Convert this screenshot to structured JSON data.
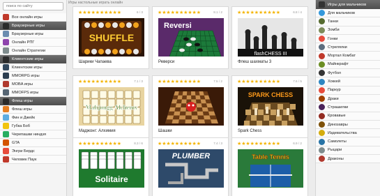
{
  "search": {
    "placeholder": "поиск по сайту"
  },
  "breadcrumb": "Игры настольные играть онлайн",
  "left_sidebar": {
    "top_item": {
      "label": "Все онлайн игры",
      "color": "#c0392b"
    },
    "groups": [
      {
        "title": "Браузерные игры",
        "items": [
          {
            "label": "Браузерные игры",
            "color": "#6a8caf"
          },
          {
            "label": "Онлайн РПГ",
            "color": "#8e44ad"
          },
          {
            "label": "Онлайн Стратегии",
            "color": "#7f8c8d"
          }
        ]
      },
      {
        "title": "Клиентские игры",
        "items": [
          {
            "label": "Клиентские игры",
            "color": "#34495e"
          },
          {
            "label": "MMORPG игры",
            "color": "#2c3e50"
          },
          {
            "label": "MOBA игры",
            "color": "#b03a2e"
          },
          {
            "label": "MMOFPS игры",
            "color": "#566573"
          }
        ]
      },
      {
        "title": "Флеш игры",
        "items": [
          {
            "label": "Флеш игры",
            "color": "#e67e22"
          },
          {
            "label": "Фин и Джейк",
            "color": "#5dade2"
          },
          {
            "label": "Губка Боб",
            "color": "#f1c40f"
          },
          {
            "label": "Черепашки ниндзя",
            "color": "#27ae60"
          },
          {
            "label": "GTA",
            "color": "#d35400"
          },
          {
            "label": "Энгри Бердс",
            "color": "#e74c3c"
          },
          {
            "label": "Человек Паук",
            "color": "#c0392b"
          }
        ]
      }
    ]
  },
  "cards": [
    {
      "title": "Шарики Чапаева",
      "score": "6 / 3",
      "stars": 5,
      "thumb": "shuffle",
      "thumb_text": "SHUFFLE"
    },
    {
      "title": "Реверси",
      "score": "8.1 / 2",
      "stars": 5,
      "thumb": "reversi",
      "thumb_text": "Reversi"
    },
    {
      "title": "Флеш шахматы 3",
      "score": "6.8 / 4",
      "stars": 5,
      "thumb": "chess",
      "thumb_text": "flashCHESS III"
    },
    {
      "title": "Маджонг: Алхимия",
      "score": "7.1 / 3",
      "stars": 5,
      "thumb": "mahjong",
      "thumb_text": "Mahjongg Alchemy"
    },
    {
      "title": "Шашки",
      "score": "7.5 / 2",
      "stars": 5,
      "thumb": "checkers",
      "thumb_text": ""
    },
    {
      "title": "Spark Chess",
      "score": "7.6 / 5",
      "stars": 5,
      "thumb": "spark",
      "thumb_text": "SPARK CHESS"
    },
    {
      "title": "",
      "score": "8.3 / 6",
      "stars": 5,
      "thumb": "solitaire",
      "thumb_text": "Solitaire"
    },
    {
      "title": "",
      "score": "7.4 / 3",
      "stars": 5,
      "thumb": "plumber",
      "thumb_text": "PLUMBER"
    },
    {
      "title": "",
      "score": "6.9 / 2",
      "stars": 5,
      "thumb": "tennis",
      "thumb_text": "Table Tennis"
    }
  ],
  "right_sidebar": {
    "title": "Игры для мальчиков",
    "items": [
      {
        "label": "Для мальчиков",
        "color": "#3498db"
      },
      {
        "label": "Танки",
        "color": "#556b2f"
      },
      {
        "label": "Зомби",
        "color": "#7d8c5a"
      },
      {
        "label": "Гонки",
        "color": "#e74c3c"
      },
      {
        "label": "Стрелялки",
        "color": "#5d6d7e"
      },
      {
        "label": "Мортал Комбат",
        "color": "#c0392b"
      },
      {
        "label": "Майнкрафт",
        "color": "#6b8e23"
      },
      {
        "label": "Футбол",
        "color": "#333333"
      },
      {
        "label": "Хоккей",
        "color": "#2e86c1"
      },
      {
        "label": "Паркур",
        "color": "#e74c3c"
      },
      {
        "label": "Драки",
        "color": "#a04000"
      },
      {
        "label": "Страшилки",
        "color": "#4a235a"
      },
      {
        "label": "Кровавые",
        "color": "#922b21"
      },
      {
        "label": "Динозавры",
        "color": "#7e5109"
      },
      {
        "label": "Издевательства",
        "color": "#d4ac0d"
      },
      {
        "label": "Самолеты",
        "color": "#2874a6"
      },
      {
        "label": "Рыцари",
        "color": "#7f8c8d"
      },
      {
        "label": "Драконы",
        "color": "#b03a2e"
      }
    ]
  }
}
